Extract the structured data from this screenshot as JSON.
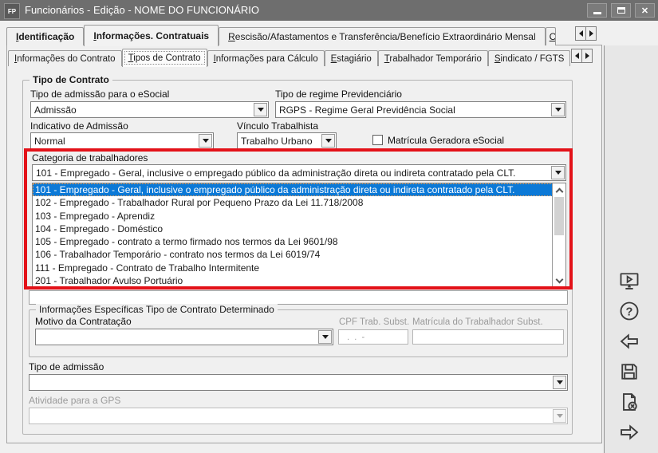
{
  "window": {
    "title": "Funcionários - Edição - NOME DO FUNCIONÁRIO",
    "icon_text": "FP",
    "controls": {
      "close_glyph": "✕"
    }
  },
  "tabs_row1": [
    {
      "label": "Identificação",
      "selected": false
    },
    {
      "label": "Informações. Contratuais",
      "selected": true
    },
    {
      "label": "Rescisão/Afastamentos e Transferência/Benefício Extraordinário Mensal",
      "selected": false
    },
    {
      "label": "C",
      "selected": false
    }
  ],
  "tabs_row2": [
    {
      "label": "Informações do Contrato",
      "selected": false
    },
    {
      "label": "Tipos de Contrato",
      "selected": true
    },
    {
      "label": "Informações para Cálculo",
      "selected": false
    },
    {
      "label": "Estagiário",
      "selected": false
    },
    {
      "label": "Trabalhador Temporário",
      "selected": false
    },
    {
      "label": "Sindicato / FGTS",
      "selected": false
    }
  ],
  "form": {
    "group_title": "Tipo de Contrato",
    "tipo_admissao_esocial": {
      "label": "Tipo de admissão para o eSocial",
      "value": "Admissão"
    },
    "tipo_regime": {
      "label": "Tipo de regime Previdenciário",
      "value": "RGPS - Regime Geral Previdência Social"
    },
    "indicativo_admissao": {
      "label": "Indicativo de Admissão",
      "value": "Normal"
    },
    "vinculo_trabalhista": {
      "label": "Vínculo Trabalhista",
      "value": "Trabalho Urbano"
    },
    "matricula_geradora": {
      "label": "Matrícula Geradora eSocial",
      "checked": false
    },
    "categoria": {
      "label": "Categoria de trabalhadores",
      "value": "101 - Empregado - Geral, inclusive o empregado público da administração direta ou indireta contratado pela CLT.",
      "selected_index": 0,
      "options": [
        "101 - Empregado - Geral, inclusive o empregado público da administração direta ou indireta contratado pela CLT.",
        "102 - Empregado - Trabalhador Rural por Pequeno Prazo da Lei 11.718/2008",
        "103 - Empregado - Aprendiz",
        "104 - Empregado - Doméstico",
        "105 - Empregado - contrato a termo firmado nos termos da Lei 9601/98",
        "106 - Trabalhador Temporário - contrato nos termos da Lei 6019/74",
        "111 - Empregado - Contrato de Trabalho Intermitente",
        "201 - Trabalhador Avulso Portuário"
      ]
    },
    "subgroup": {
      "title": "Informações Específicas Tipo de Contrato Determinado",
      "motivo_contratacao": {
        "label": "Motivo da Contratação",
        "value": ""
      },
      "cpf_trab_subst": {
        "label": "CPF Trab. Subst.",
        "mask": "  .  .  -"
      },
      "matricula_trab_subst": {
        "label": "Matrícula do Trabalhador Subst.",
        "value": ""
      }
    },
    "tipo_admissao": {
      "label": "Tipo de admissão",
      "value": ""
    },
    "atividade_gps": {
      "label": "Atividade para a GPS",
      "value": ""
    }
  },
  "annotation": {
    "highlight_border_color": "#e31219"
  },
  "colors": {
    "selection_blue": "#0b79d7",
    "titlebar_gray": "#6e6e6e"
  },
  "sidebar_icons": [
    "presentation",
    "help",
    "back",
    "save",
    "cancel-document",
    "forward"
  ]
}
